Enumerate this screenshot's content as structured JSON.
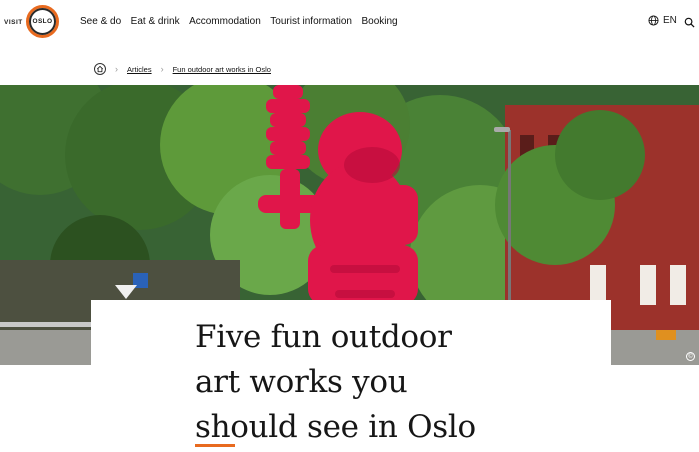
{
  "header": {
    "logo": {
      "visit": "VISIT",
      "city": "OSLO"
    },
    "nav": [
      "See & do",
      "Eat & drink",
      "Accommodation",
      "Tourist information",
      "Booking"
    ],
    "language": "EN",
    "colors": {
      "accent": "#e86a1f"
    }
  },
  "breadcrumb": {
    "home_icon": "home-icon",
    "items": [
      "Articles",
      "Fun outdoor art works in Oslo"
    ]
  },
  "hero": {
    "copyright_symbol": "©"
  },
  "article": {
    "title_lines": [
      "Five fun outdoor",
      "art works you",
      "should see in Oslo"
    ]
  }
}
